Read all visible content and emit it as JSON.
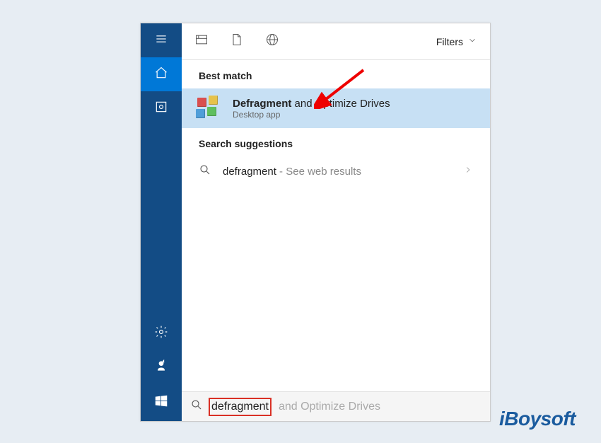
{
  "rail": {
    "items": [
      {
        "name": "menu"
      },
      {
        "name": "home",
        "active": true
      },
      {
        "name": "gallery"
      }
    ],
    "bottom": [
      {
        "name": "settings"
      },
      {
        "name": "feedback"
      },
      {
        "name": "start"
      }
    ]
  },
  "toolbar": {
    "filters_label": "Filters"
  },
  "best_match": {
    "header": "Best match",
    "title_bold": "Defragment",
    "title_rest": " and Optimize Drives",
    "subtitle": "Desktop app"
  },
  "suggestions": {
    "header": "Search suggestions",
    "items": [
      {
        "term": "defragment",
        "extra": " - See web results"
      }
    ]
  },
  "search": {
    "typed": "defragment",
    "ghost": " and Optimize Drives"
  },
  "watermark": "iBoysoft"
}
